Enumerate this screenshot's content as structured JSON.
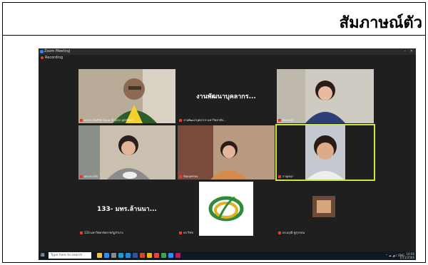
{
  "document": {
    "title": "สัมภาษณ์ตัว"
  },
  "meeting": {
    "app_name": "Zoom Meeting",
    "recording_label": "Recording",
    "tiles": [
      {
        "name": "ผศ.ดร.สันติชัย รัตนมาลี (มรภ.อุตรดิตถ์)",
        "type": "video",
        "active": false
      },
      {
        "name": "งานพัฒนาบุคลากร มหาวิทยาลัย...",
        "display_text": "งานพัฒนาบุคลากร...",
        "type": "text",
        "active": false
      },
      {
        "name": "ปิยะนันท์",
        "type": "video",
        "active": false
      },
      {
        "name": "ผศ.ดร.จริย",
        "type": "video",
        "active": false
      },
      {
        "name": "ปัณณพรรณ",
        "type": "video",
        "active": false
      },
      {
        "name": "กาญจนา",
        "type": "video",
        "active": true
      },
      {
        "name": "133-มหาวิทยาลัยราชภัฏลำปาง",
        "display_text": "133- มทร.ล้านนา...",
        "type": "text",
        "active": false
      },
      {
        "name": "ดร.วิชช",
        "type": "logo",
        "active": false
      },
      {
        "name": "ดร.อรุณี ชูสุวรรณ",
        "type": "video",
        "active": false
      }
    ]
  },
  "taskbar": {
    "search_placeholder": "Type here to search",
    "time": "14:06",
    "date": "1/11/2566"
  },
  "colors": {
    "active_border": "#c8e64a",
    "zoom_blue": "#2d8cff",
    "mic_off": "#e53935"
  }
}
